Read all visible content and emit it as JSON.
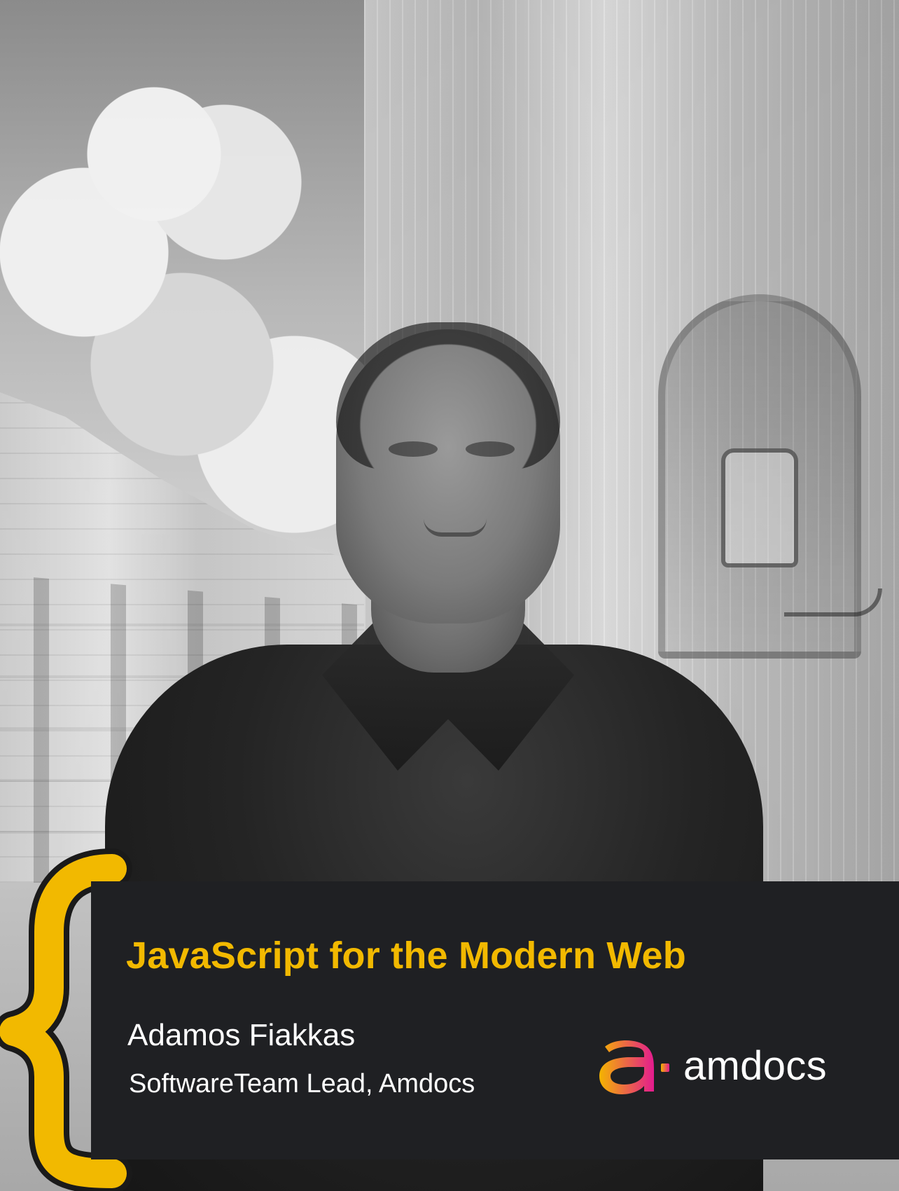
{
  "card": {
    "title": "JavaScript for the Modern Web",
    "speaker_name": "Adamos Fiakkas",
    "speaker_role": "SoftwareTeam Lead, Amdocs"
  },
  "logo": {
    "text": "amdocs"
  },
  "colors": {
    "accent": "#f2b900",
    "banner_bg": "#1f2023",
    "text": "#ffffff",
    "logo_gradient_start": "#f4b400",
    "logo_gradient_end": "#e31b8f"
  },
  "icons": {
    "brace": "left-curly-brace-icon",
    "logo_mark": "amdocs-logo-mark-icon"
  }
}
